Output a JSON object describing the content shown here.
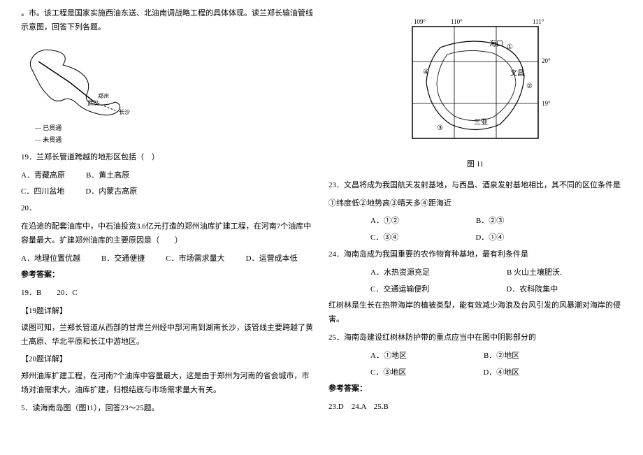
{
  "left": {
    "intro1": "。市。该工程是国家实施西油东送、北油南调战略工程的具体体现。读兰郑长输油管线示意图，回答下列各题。",
    "legend1": "— 已贯通",
    "legend2": "— 未贯通",
    "q19": "19．兰郑长管道跨越的地形区包括（　）",
    "q19_a": "A．青藏高原",
    "q19_b": "B．黄土高原",
    "q19_c": "C．四川盆地",
    "q19_d": "D．内蒙古高原",
    "q20_num": "20．",
    "q20_text": "在沿途的配套油库中，中石油投资3.6亿元打造的郑州油库扩建工程，在河南7个油库中容量最大。扩建郑州油库的主要原因是（　　）",
    "q20_a": "A．地理位置优越",
    "q20_b": "B．交通便捷",
    "q20_c": "C．市场需求量大",
    "q20_d": "D．运营成本低",
    "answer_label": "参考答案：",
    "answer_text": "19．B　　20．C",
    "detail19_title": "【19题详解】",
    "detail19_text": "读图可知，兰郑长管道从西部的甘肃兰州经中部河南到湖南长沙，该管线主要跨越了黄土高原、华北平原和长江中游地区。",
    "detail20_title": "【20题详解】",
    "detail20_text": "郑州油库扩建工程，在河南7个油库中容量最大，这是由于郑州为河南的省会城市，市场对油需求大，油库扩建，归根结底与市场需求量大有关。",
    "q5": "5．读海南岛图（图11），回答23～25题。"
  },
  "right": {
    "map_labels": {
      "lon1": "109°",
      "lon2": "110°",
      "lon3": "111°",
      "lat1": "20°",
      "lat2": "19°",
      "city1": "海口",
      "city2": "文昌",
      "city3": "三亚",
      "n1": "①",
      "n2": "②",
      "n3": "③",
      "n4": "④"
    },
    "fig_caption": "图 11",
    "q23": "23．文昌将成为我国航天发射基地，与西昌、酒泉发射基地相比，其不同的区位条件是",
    "q23_opts": "①纬度低②地势高③晴天多④距海近",
    "q23_a": "A．①②",
    "q23_b": "B．②③",
    "q23_c": "C．③④",
    "q23_d": "D．①④",
    "q24": "24．海南岛成为我国重要的农作物育种基地，最有利条件是",
    "q24_a": "A．水热资源充足",
    "q24_b": "B 火山土壤肥沃.",
    "q24_c": "C．交通运输便利",
    "q24_d": "D．农科院集中",
    "mangrove": "红树林是生长在热带海岸的植被类型，能有效减少海浪及台风引发的风暴潮对海岸的侵害。",
    "q25": "25．海南岛建设红树林防护带的重点应当中在图中阴影部分的",
    "q25_a": "A．①地区",
    "q25_b": "B．②地区",
    "q25_c": "C．③地区",
    "q25_d": "D．④地区",
    "answer_label": "参考答案：",
    "answer_text": "23.D　24.A　25.B"
  }
}
